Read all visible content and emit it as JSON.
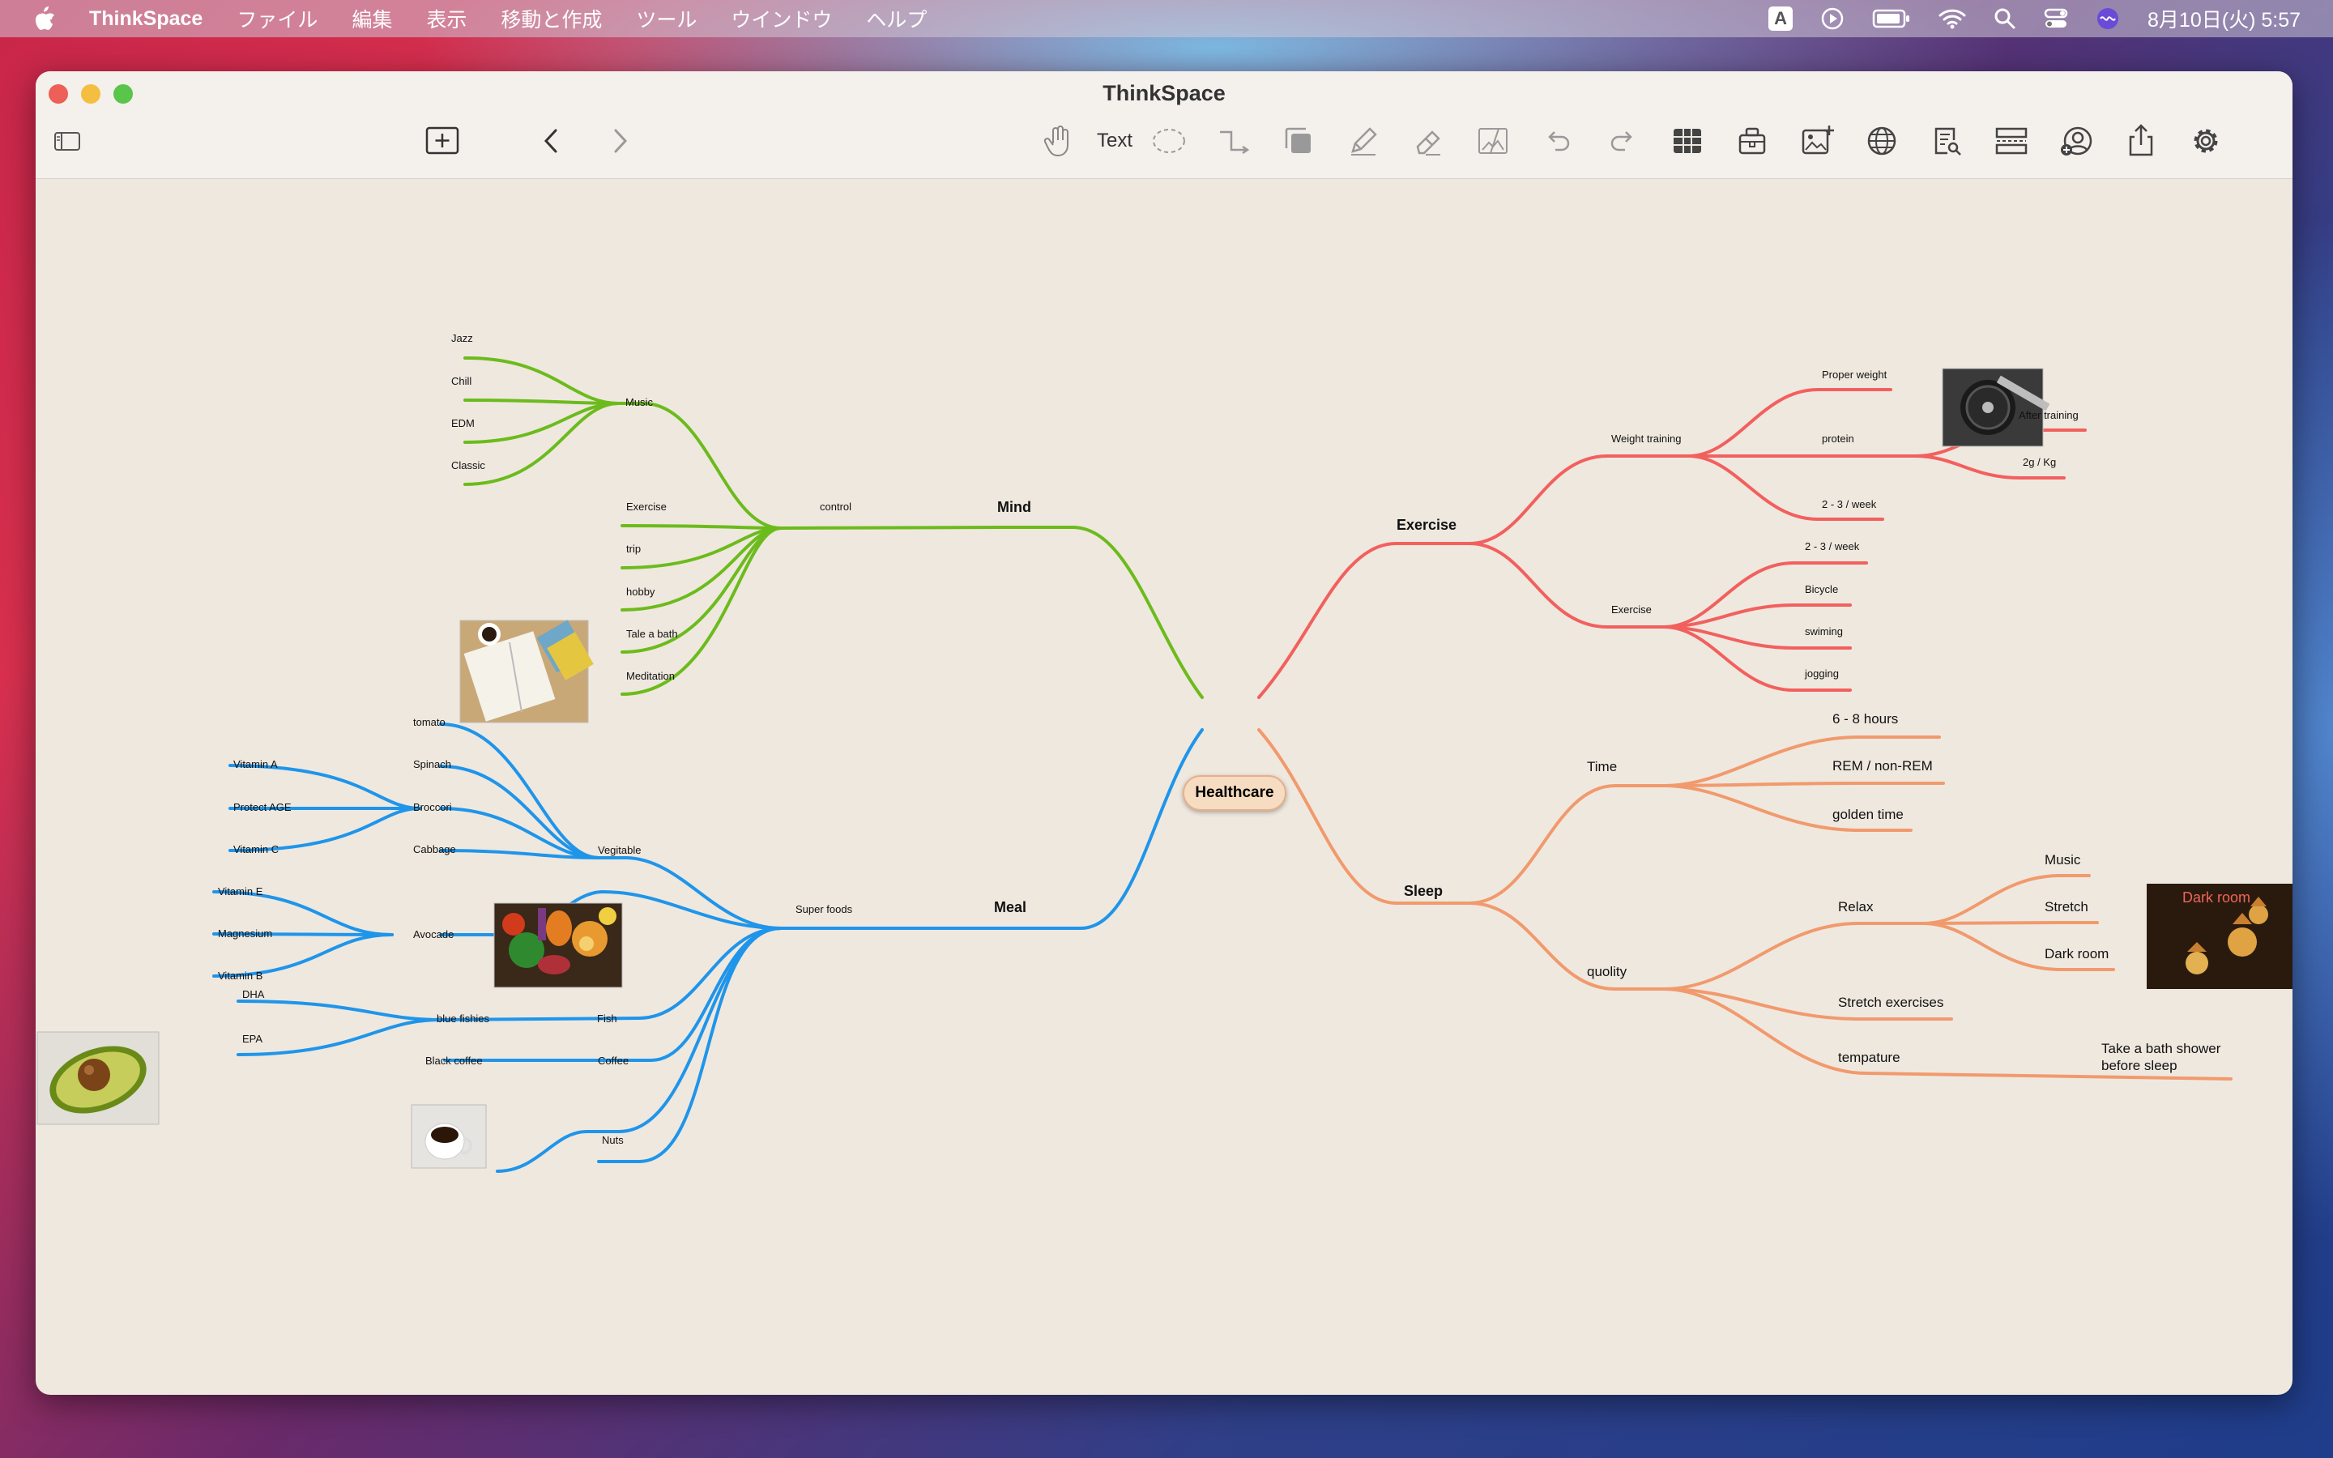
{
  "menubar": {
    "app_name": "ThinkSpace",
    "menus": [
      "ファイル",
      "編集",
      "表示",
      "移動と作成",
      "ツール",
      "ウインドウ",
      "ヘルプ"
    ],
    "input_indicator": "A",
    "datetime": "8月10日(火)  5:57"
  },
  "window": {
    "title": "ThinkSpace",
    "toolbar": {
      "text_tool_label": "Text"
    }
  },
  "mindmap": {
    "central": "Healthcare",
    "branch_colors": {
      "mind": "#6cbb1c",
      "meal": "#1f95ea",
      "exercise": "#f2605e",
      "sleep": "#f19a6d"
    },
    "mind": {
      "label": "Mind",
      "music": {
        "label": "Music",
        "items": [
          "Jazz",
          "Chill",
          "EDM",
          "Classic"
        ]
      },
      "control": {
        "label": "control",
        "items": [
          "Exercise",
          "trip",
          "hobby",
          "Tale a bath",
          "Meditation"
        ]
      }
    },
    "meal": {
      "label": "Meal",
      "superfoods": "Super foods",
      "vegitable": {
        "label": "Vegitable",
        "items": [
          "tomato",
          "Spinach",
          "Broccori",
          "Cabbage"
        ],
        "broccori_items": [
          "Vitamin A",
          "Protect AGE",
          "Vitamin C"
        ]
      },
      "avocade": {
        "label": "Avocade",
        "items": [
          "Vitamin E",
          "Magnesium",
          "Vitamin B"
        ]
      },
      "fish": {
        "label": "Fish",
        "blue": "blue fishies",
        "items": [
          "DHA",
          "EPA"
        ]
      },
      "coffee": {
        "label": "Coffee",
        "item": "Black coffee"
      },
      "nuts": "Nuts"
    },
    "exercise": {
      "label": "Exercise",
      "weight": {
        "label": "Weight training",
        "proper": "Proper weight",
        "protein": "protein",
        "protein_items": [
          "After training",
          "2g / Kg"
        ],
        "freq": "2 - 3 / week"
      },
      "exercise": {
        "label": "Exercise",
        "items": [
          "2 - 3 / week",
          "Bicycle",
          "swiming",
          "jogging"
        ]
      }
    },
    "sleep": {
      "label": "Sleep",
      "time": {
        "label": "Time",
        "items": [
          "6 - 8 hours",
          "REM / non-REM",
          "golden time"
        ]
      },
      "quality": {
        "label": "quolity",
        "relax": {
          "label": "Relax",
          "items": [
            "Music",
            "Stretch",
            "Dark room"
          ]
        },
        "stretch": "Stretch exercises",
        "temp": {
          "label": "tempature",
          "note_line1": "Take a bath shower",
          "note_line2": "before sleep"
        }
      }
    },
    "image_caption": "Dark room"
  }
}
